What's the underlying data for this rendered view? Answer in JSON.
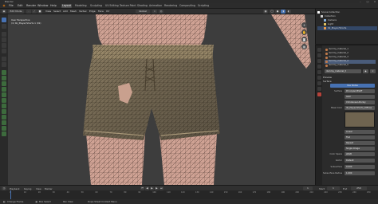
{
  "window": {
    "title": "Blender"
  },
  "menubar": {
    "items": [
      "File",
      "Edit",
      "Render",
      "Window",
      "Help"
    ],
    "workspaces": [
      "Layout",
      "Modeling",
      "Sculpting",
      "UV Editing",
      "Texture Paint",
      "Shading",
      "Animation",
      "Rendering",
      "Compositing",
      "Scripting"
    ],
    "active_workspace": "Layout"
  },
  "viewport_header": {
    "mode": "Edit Mode",
    "menus": [
      "View",
      "Select",
      "Add",
      "Mesh",
      "Vertex",
      "Edge",
      "Face",
      "UV"
    ],
    "transform": "Global"
  },
  "viewport": {
    "overlay_line1": "User Perspective",
    "overlay_line2": "(1) lbl_Player/Shorts 1 (01)"
  },
  "outliner": {
    "rows": [
      "Scene Collection",
      "Collection",
      "Camera",
      "Light",
      "lbl_Player/Shorts"
    ]
  },
  "properties": {
    "material_slots": [
      "dummy_material_1",
      "dummy_material_2",
      "dummy_material_3",
      "dummy_material_4",
      "dummy_material_5"
    ],
    "selected_slot": 4,
    "material_name": "dummy_material_3",
    "sections": [
      "Preview",
      "Surface"
    ],
    "use_nodes": "Use Nodes",
    "surface_label": "Surface",
    "surface_value": "Principled BSDF",
    "distribution": "GGX",
    "subsurface_method": "Christensen-Burley",
    "base_color_label": "Base Color",
    "base_color_value": "lbl_Player/Shorts_Diffuse",
    "texture_fields": [
      "Linear",
      "Flat",
      "Repeat",
      "Single Image"
    ],
    "color_space_label": "Color Space",
    "color_space_value": "sRGB",
    "vector_label": "Vector",
    "vector_value": "Default",
    "subsurface_label": "Subsurface",
    "subsurface_value": "0.000",
    "subsurface_radius_label": "Subsurface Radius",
    "subsurface_radius_value": "1.000"
  },
  "timeline": {
    "menus": [
      "Playback",
      "Keying",
      "View",
      "Marker"
    ],
    "start_label": "Start",
    "start_value": "1",
    "end_label": "End",
    "end_value": "250",
    "current_frame": "1",
    "ticks": [
      "0",
      "10",
      "20",
      "30",
      "40",
      "50",
      "60",
      "70",
      "80",
      "90",
      "100",
      "110",
      "120",
      "130",
      "140",
      "150",
      "160",
      "170",
      "180",
      "190",
      "200",
      "210",
      "220",
      "230",
      "240",
      "250"
    ]
  },
  "statusbar": {
    "left": "Change Frame",
    "mid1": "Box Select",
    "mid2": "Pan View",
    "right": "Dope Sheet Context Menu"
  },
  "colors": {
    "accent": "#4772b3",
    "viewport_bg": "#3d3d3d",
    "skin": "#cfa294",
    "fabric": "#7e7158"
  }
}
